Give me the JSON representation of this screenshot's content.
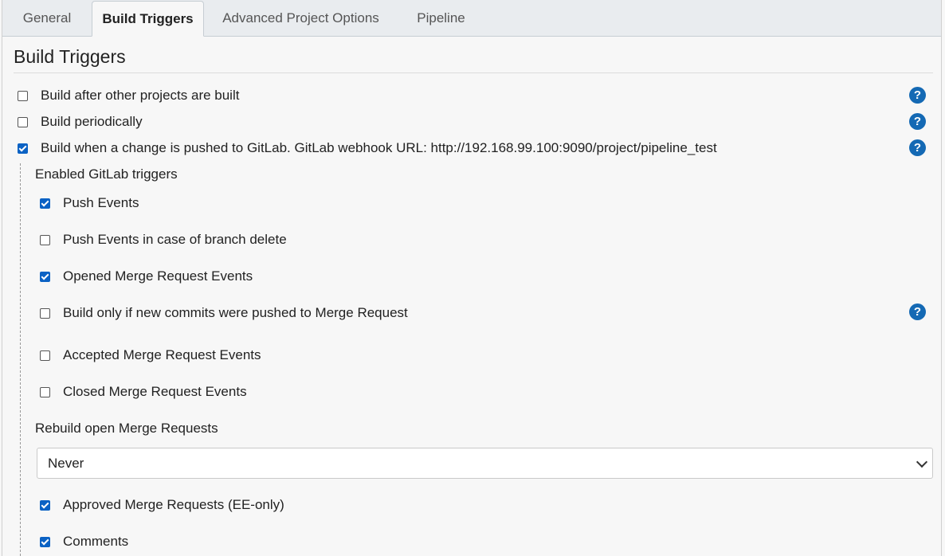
{
  "tabs": [
    {
      "label": "General",
      "active": false
    },
    {
      "label": "Build Triggers",
      "active": true
    },
    {
      "label": "Advanced Project Options",
      "active": false
    },
    {
      "label": "Pipeline",
      "active": false
    }
  ],
  "section": {
    "title": "Build Triggers"
  },
  "triggers": [
    {
      "label": "Build after other projects are built",
      "checked": false
    },
    {
      "label": "Build periodically",
      "checked": false
    },
    {
      "label": "Build when a change is pushed to GitLab. GitLab webhook URL: http://192.168.99.100:9090/project/pipeline_test",
      "checked": true
    }
  ],
  "help_glyph": "?",
  "gitlab": {
    "enabled_label": "Enabled GitLab triggers",
    "options": [
      {
        "label": "Push Events",
        "checked": true
      },
      {
        "label": "Push Events in case of branch delete",
        "checked": false
      },
      {
        "label": "Opened Merge Request Events",
        "checked": true
      },
      {
        "label": "Build only if new commits were pushed to Merge Request",
        "checked": false
      },
      {
        "label": "Accepted Merge Request Events",
        "checked": false
      },
      {
        "label": "Closed Merge Request Events",
        "checked": false
      },
      {
        "label": "Approved Merge Requests (EE-only)",
        "checked": true
      },
      {
        "label": "Comments",
        "checked": true
      }
    ],
    "rebuild_label": "Rebuild open Merge Requests",
    "rebuild_select": {
      "selected": "Never"
    }
  },
  "colors": {
    "accent": "#0b62c4",
    "help": "#1469b4"
  }
}
